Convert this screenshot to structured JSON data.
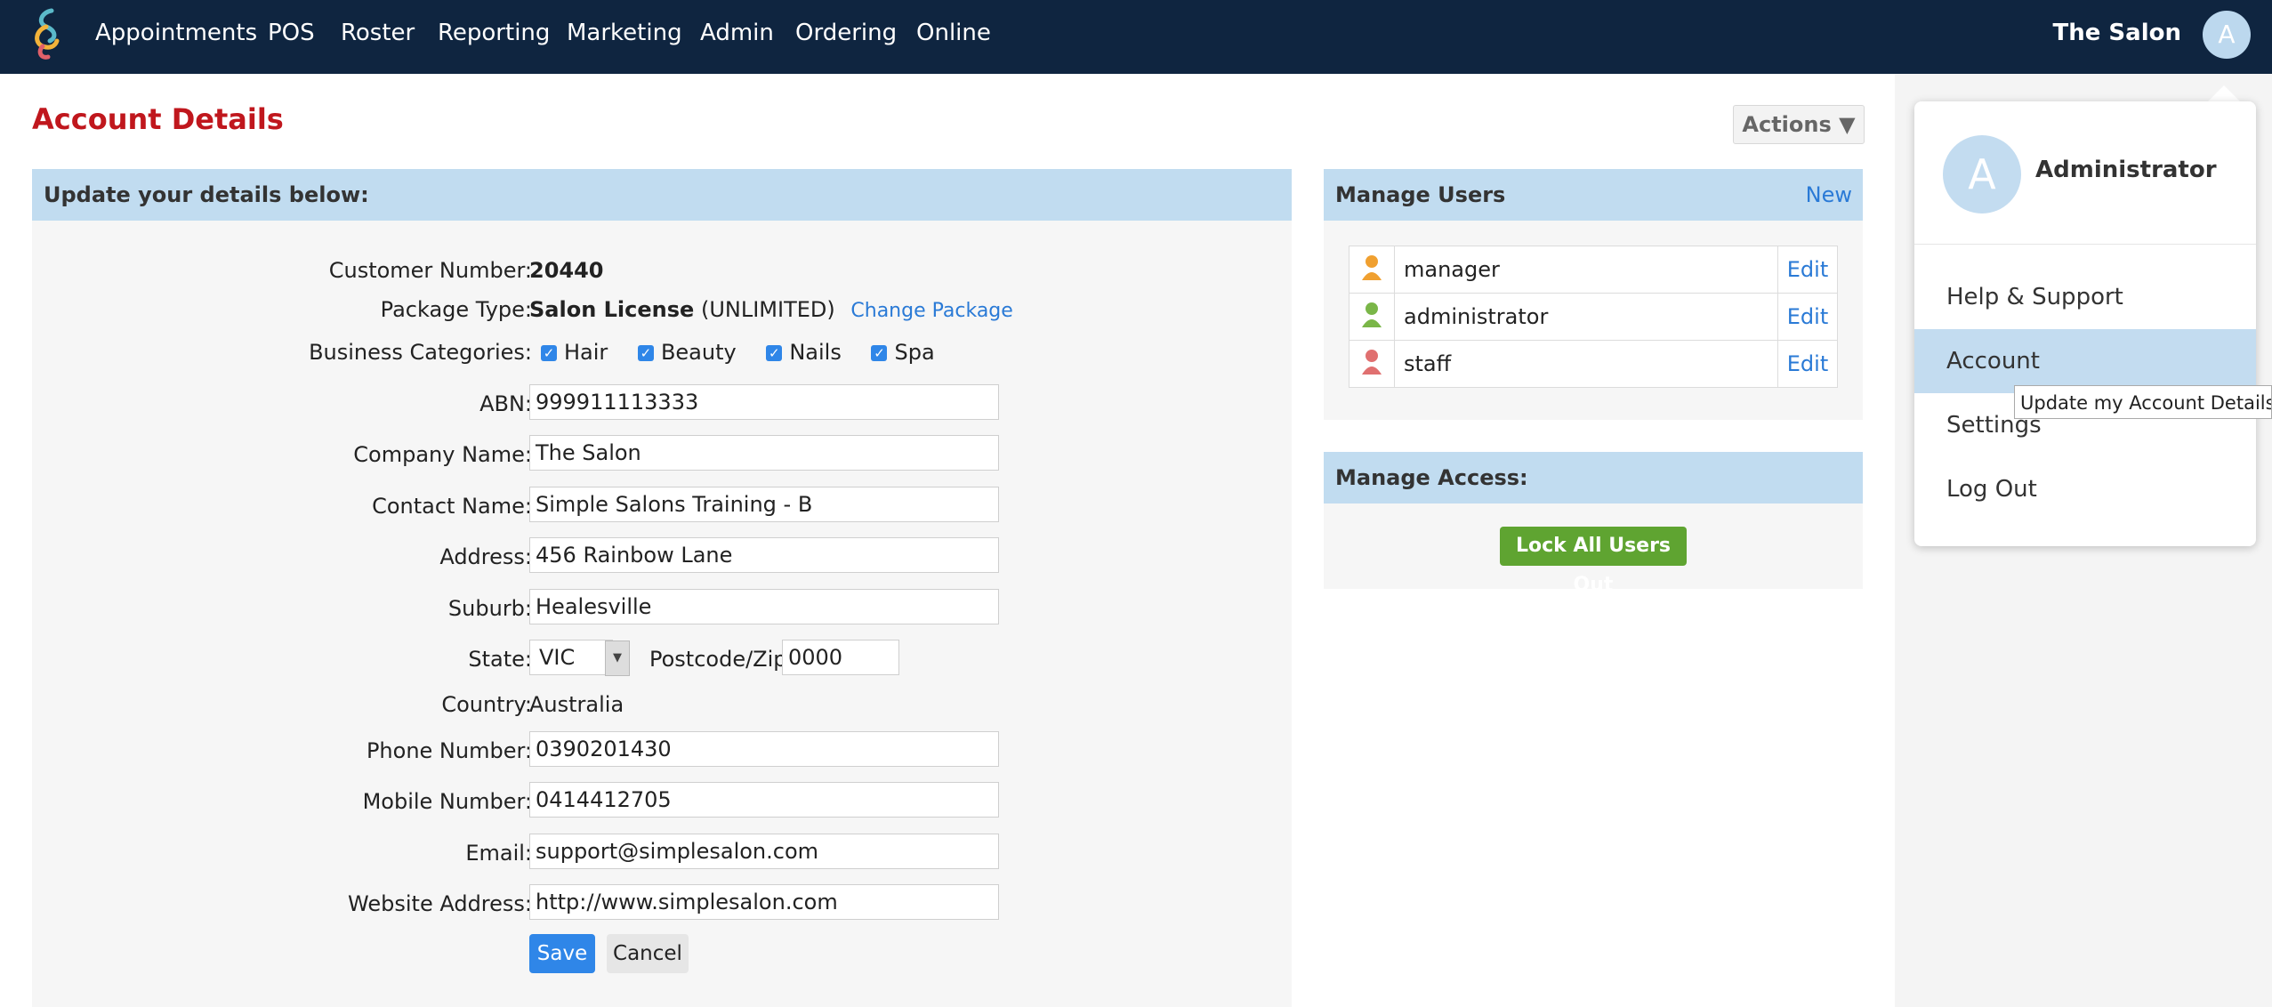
{
  "nav": {
    "items": [
      "Appointments",
      "POS",
      "Roster",
      "Reporting",
      "Marketing",
      "Admin",
      "Ordering",
      "Online"
    ],
    "salon_name": "The Salon",
    "avatar_letter": "A"
  },
  "page": {
    "title": "Account Details",
    "actions_label": "Actions ▼"
  },
  "form": {
    "header": "Update your details below:",
    "customer_number_label": "Customer Number:",
    "customer_number": "20440",
    "package_type_label": "Package Type:",
    "package_name": "Salon License",
    "package_suffix": "(UNLIMITED)",
    "change_package": "Change Package",
    "business_categories_label": "Business Categories:",
    "categories": [
      "Hair",
      "Beauty",
      "Nails",
      "Spa"
    ],
    "abn_label": "ABN:",
    "abn": "999911113333",
    "company_name_label": "Company Name:",
    "company_name": "The Salon",
    "contact_name_label": "Contact Name:",
    "contact_name": "Simple Salons Training - B",
    "address_label": "Address:",
    "address": "456 Rainbow Lane",
    "suburb_label": "Suburb:",
    "suburb": "Healesville",
    "state_label": "State:",
    "state": "VIC",
    "postcode_label": "Postcode/Zip:",
    "postcode": "0000",
    "country_label": "Country:",
    "country": "Australia",
    "phone_label": "Phone Number:",
    "phone": "0390201430",
    "mobile_label": "Mobile Number:",
    "mobile": "0414412705",
    "email_label": "Email:",
    "email": "support@simplesalon.com",
    "website_label": "Website Address:",
    "website": "http://www.simplesalon.com",
    "save": "Save",
    "cancel": "Cancel"
  },
  "users": {
    "header": "Manage Users",
    "new_label": "New",
    "edit_label": "Edit",
    "rows": [
      {
        "name": "manager",
        "icon_color": "#f0a030"
      },
      {
        "name": "administrator",
        "icon_color": "#7ab648"
      },
      {
        "name": "staff",
        "icon_color": "#e07070"
      }
    ]
  },
  "access": {
    "header": "Manage Access:",
    "lock_button": "Lock All Users Out"
  },
  "dropdown": {
    "avatar_letter": "A",
    "user_name": "Administrator",
    "items": [
      "Help & Support",
      "Account",
      "Settings",
      "Log Out"
    ],
    "tooltip": "Update my Account Details"
  }
}
